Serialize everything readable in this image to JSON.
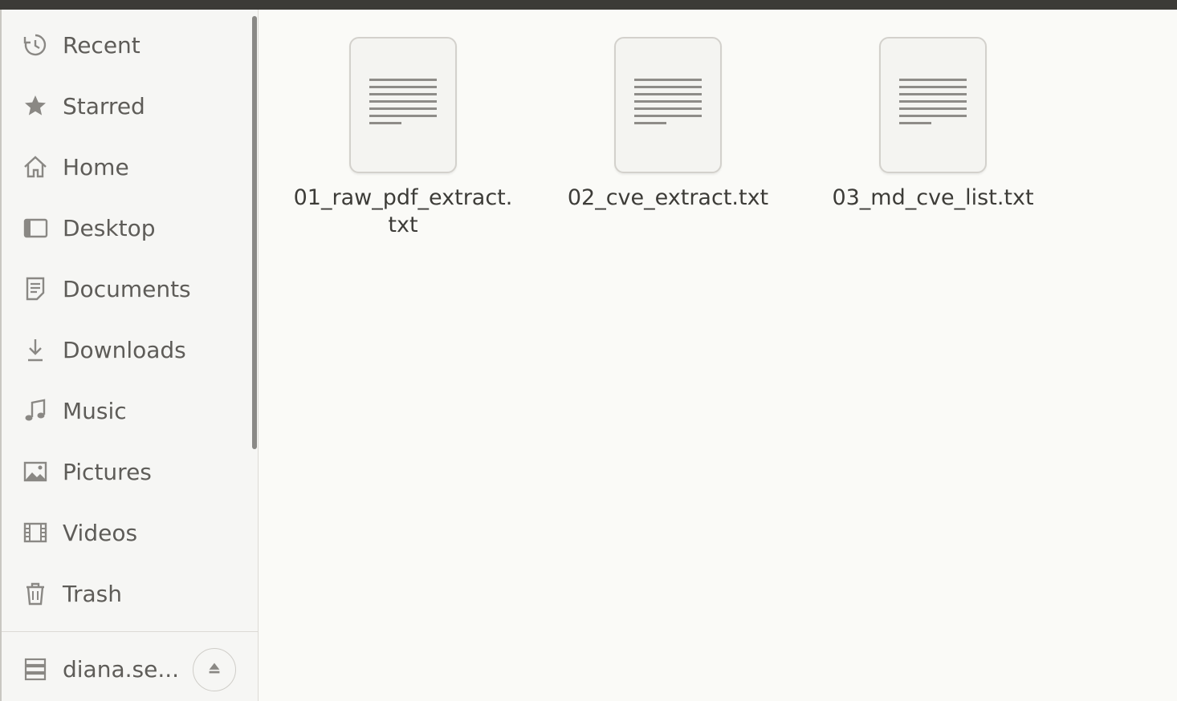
{
  "sidebar": {
    "items": [
      {
        "label": "Recent",
        "icon": "clock-icon"
      },
      {
        "label": "Starred",
        "icon": "star-icon"
      },
      {
        "label": "Home",
        "icon": "home-icon"
      },
      {
        "label": "Desktop",
        "icon": "desktop-icon"
      },
      {
        "label": "Documents",
        "icon": "document-icon"
      },
      {
        "label": "Downloads",
        "icon": "download-icon"
      },
      {
        "label": "Music",
        "icon": "music-icon"
      },
      {
        "label": "Pictures",
        "icon": "picture-icon"
      },
      {
        "label": "Videos",
        "icon": "video-icon"
      },
      {
        "label": "Trash",
        "icon": "trash-icon"
      }
    ],
    "drive": {
      "label": "diana.se...",
      "icon": "drive-icon"
    }
  },
  "files": [
    {
      "name_line1": "01_raw_pdf_extract.",
      "name_line2": "txt",
      "icon": "text-file-icon"
    },
    {
      "name_line1": "02_cve_extract.txt",
      "name_line2": "",
      "icon": "text-file-icon"
    },
    {
      "name_line1": "03_md_cve_list.txt",
      "name_line2": "",
      "icon": "text-file-icon"
    }
  ],
  "colors": {
    "topbar": "#3c3b37",
    "sidebar_bg": "#f6f6f4",
    "main_bg": "#fafaf7",
    "text": "#5e5c58"
  }
}
